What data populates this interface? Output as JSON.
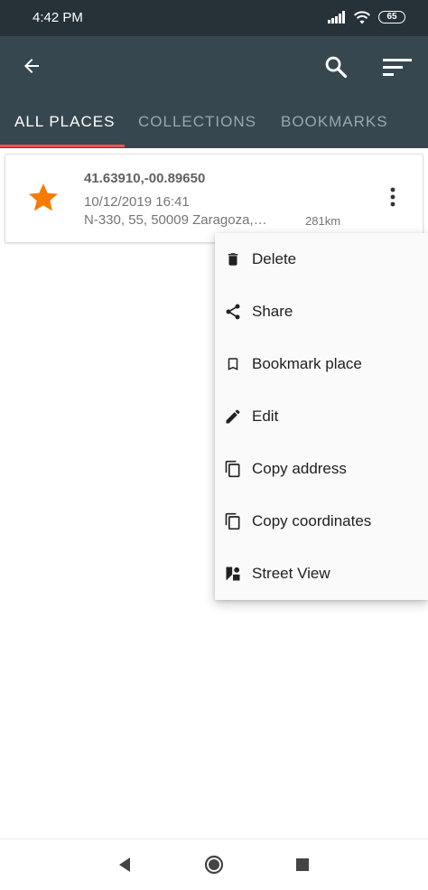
{
  "status_bar": {
    "time": "4:42 PM",
    "battery": "65"
  },
  "app_bar": {
    "icons": {
      "back": "arrow-left-icon",
      "search": "search-icon",
      "sort": "sort-icon"
    }
  },
  "tabs": [
    {
      "label": "ALL PLACES",
      "active": true
    },
    {
      "label": "COLLECTIONS",
      "active": false
    },
    {
      "label": "BOOKMARKS",
      "active": false
    }
  ],
  "place": {
    "coordinates": "41.63910,-00.89650",
    "date": "10/12/2019 16:41",
    "address": "N-330, 55, 50009 Zaragoza,…",
    "distance": "281km",
    "star_color": "#f57c00"
  },
  "menu": {
    "items": [
      {
        "label": "Delete",
        "icon": "trash-icon"
      },
      {
        "label": "Share",
        "icon": "share-icon"
      },
      {
        "label": "Bookmark place",
        "icon": "bookmark-icon"
      },
      {
        "label": "Edit",
        "icon": "pencil-icon"
      },
      {
        "label": "Copy address",
        "icon": "copy-icon"
      },
      {
        "label": "Copy coordinates",
        "icon": "copy-icon"
      },
      {
        "label": "Street View",
        "icon": "street-view-icon"
      }
    ]
  },
  "colors": {
    "app_bar": "#37474f",
    "status_bar": "#263238",
    "tab_indicator": "#ef5350",
    "accent_star": "#f57c00"
  }
}
